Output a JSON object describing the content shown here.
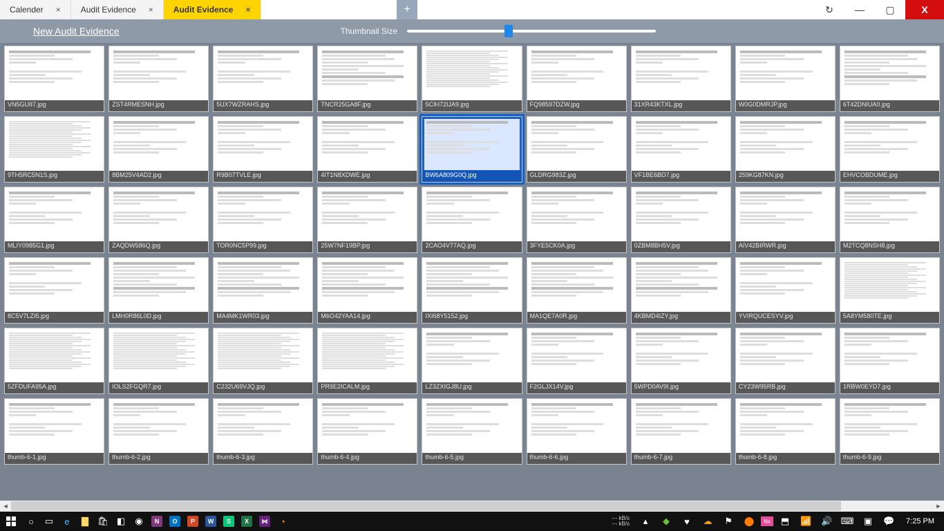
{
  "titlebar": {
    "tabs": [
      {
        "label": "Calender",
        "active": false
      },
      {
        "label": "Audit Evidence",
        "active": false
      },
      {
        "label": "Audit Evidence",
        "active": true
      }
    ],
    "newtab_symbol": "+",
    "close_symbol": "×",
    "window": {
      "refresh": "↻",
      "min": "—",
      "max": "▢",
      "close": "X"
    }
  },
  "toolbar": {
    "new_link": "New Audit Evidence",
    "slider_label": "Thumbnail Size",
    "slider_value_pct": 39
  },
  "thumbnails": [
    {
      "name": "VN5GUII7.jpg",
      "kind": "voucher"
    },
    {
      "name": "ZST4RMESNH.jpg",
      "kind": "voucher"
    },
    {
      "name": "5UX7WZRAHS.jpg",
      "kind": "voucher"
    },
    {
      "name": "TNCR25GA8F.jpg",
      "kind": "ledger"
    },
    {
      "name": "5CIH72IJA9.jpg",
      "kind": "textlist"
    },
    {
      "name": "FQ98597DZW.jpg",
      "kind": "voucher"
    },
    {
      "name": "31XR43KTXL.jpg",
      "kind": "voucher"
    },
    {
      "name": "W0G0DMRJP.jpg",
      "kind": "voucher"
    },
    {
      "name": "6T42DNIUA0.jpg",
      "kind": "ledger"
    },
    {
      "name": "9TH5RC5N1S.jpg",
      "kind": "textlist"
    },
    {
      "name": "8BM25V4AD2.jpg",
      "kind": "voucher"
    },
    {
      "name": "R9B07TVLE.jpg",
      "kind": "voucher"
    },
    {
      "name": "4IT1N8XDWE.jpg",
      "kind": "voucher"
    },
    {
      "name": "BW6A809G0Q.jpg",
      "kind": "voucher",
      "selected": true
    },
    {
      "name": "GLDRG983Z.jpg",
      "kind": "voucher"
    },
    {
      "name": "VF1BE6BD7.jpg",
      "kind": "voucher"
    },
    {
      "name": "259KG87KN.jpg",
      "kind": "voucher"
    },
    {
      "name": "EHVCOBDUME.jpg",
      "kind": "voucher"
    },
    {
      "name": "MLIY0985G1.jpg",
      "kind": "voucher"
    },
    {
      "name": "ZAQDW586Q.jpg",
      "kind": "voucher"
    },
    {
      "name": "TOR0NC5P99.jpg",
      "kind": "voucher"
    },
    {
      "name": "25W7NF19BP.jpg",
      "kind": "voucher"
    },
    {
      "name": "2CAO4V77AQ.jpg",
      "kind": "voucher"
    },
    {
      "name": "3FYE5CK0A.jpg",
      "kind": "voucher"
    },
    {
      "name": "0ZBM8BH5V.jpg",
      "kind": "voucher"
    },
    {
      "name": "AIV42BIRWR.jpg",
      "kind": "voucher"
    },
    {
      "name": "M2TCQ8NSH8.jpg",
      "kind": "voucher"
    },
    {
      "name": "8C5V7LZI5.jpg",
      "kind": "voucher"
    },
    {
      "name": "LMH0R86L0D.jpg",
      "kind": "ledger"
    },
    {
      "name": "MA4MK1WR03.jpg",
      "kind": "ledger"
    },
    {
      "name": "M6O42YAA14.jpg",
      "kind": "ledger"
    },
    {
      "name": "IXI68Y5152.jpg",
      "kind": "ledger"
    },
    {
      "name": "MA1QE7A0R.jpg",
      "kind": "ledger"
    },
    {
      "name": "4KBMD4IZY.jpg",
      "kind": "ledger"
    },
    {
      "name": "YVIRQUCESYV.jpg",
      "kind": "voucher"
    },
    {
      "name": "5A8YM580TE.jpg",
      "kind": "textlist"
    },
    {
      "name": "5ZFDUFA95A.jpg",
      "kind": "textlist"
    },
    {
      "name": "IOLS2FGQR7.jpg",
      "kind": "textlist"
    },
    {
      "name": "C232U69VJQ.jpg",
      "kind": "textlist"
    },
    {
      "name": "PR9E2ICALM.jpg",
      "kind": "textlist"
    },
    {
      "name": "LZ3ZXIGJ8U.jpg",
      "kind": "voucher"
    },
    {
      "name": "F2GLJX14V.jpg",
      "kind": "voucher"
    },
    {
      "name": "5WPD0AV9I.jpg",
      "kind": "voucher"
    },
    {
      "name": "CY23W95RB.jpg",
      "kind": "voucher"
    },
    {
      "name": "1RBW0EYD7.jpg",
      "kind": "voucher"
    },
    {
      "name": "thumb-6-1.jpg",
      "kind": "voucher"
    },
    {
      "name": "thumb-6-2.jpg",
      "kind": "voucher"
    },
    {
      "name": "thumb-6-3.jpg",
      "kind": "voucher"
    },
    {
      "name": "thumb-6-4.jpg",
      "kind": "voucher"
    },
    {
      "name": "thumb-6-5.jpg",
      "kind": "voucher"
    },
    {
      "name": "thumb-6-6.jpg",
      "kind": "voucher"
    },
    {
      "name": "thumb-6-7.jpg",
      "kind": "voucher"
    },
    {
      "name": "thumb-6-8.jpg",
      "kind": "voucher"
    },
    {
      "name": "thumb-6-9.jpg",
      "kind": "voucher"
    }
  ],
  "taskbar": {
    "net_down": "--- kB/s",
    "net_up": "--- kB/s",
    "time": "7:25 PM"
  }
}
